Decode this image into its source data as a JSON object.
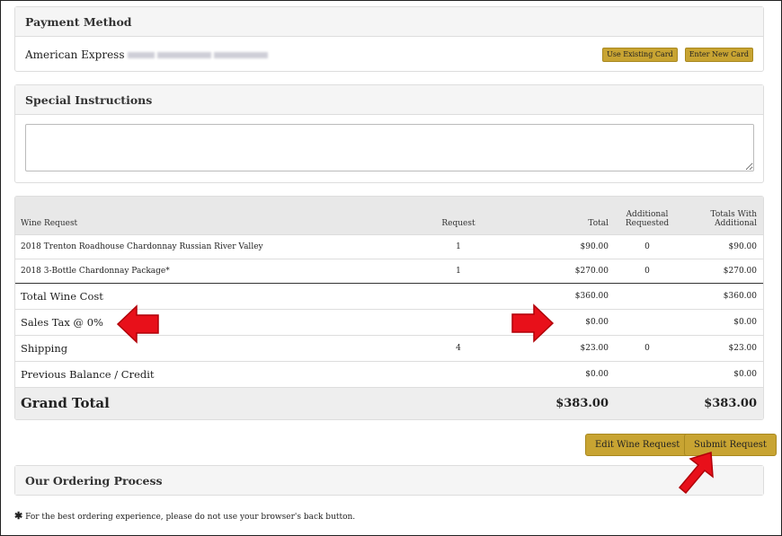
{
  "payment": {
    "title": "Payment Method",
    "card_label": "American Express",
    "use_existing_label": "Use Existing Card",
    "enter_new_label": "Enter New Card"
  },
  "instructions": {
    "title": "Special Instructions",
    "value": ""
  },
  "wine_table": {
    "headers": {
      "wine": "Wine Request",
      "request": "Request",
      "total": "Total",
      "additional1": "Additional",
      "additional2": "Requested",
      "totals_with1": "Totals With",
      "totals_with2": "Additional"
    },
    "rows": [
      {
        "wine": "2018 Trenton Roadhouse Chardonnay Russian River Valley",
        "request": "1",
        "total": "$90.00",
        "additional": "0",
        "totals_with": "$90.00"
      },
      {
        "wine": "2018 3-Bottle Chardonnay Package*",
        "request": "1",
        "total": "$270.00",
        "additional": "0",
        "totals_with": "$270.00"
      }
    ],
    "summary": [
      {
        "label": "Total Wine Cost",
        "request": "",
        "total": "$360.00",
        "additional": "",
        "totals_with": "$360.00"
      },
      {
        "label": "Sales Tax @ 0%",
        "request": "",
        "total": "$0.00",
        "additional": "",
        "totals_with": "$0.00"
      },
      {
        "label": "Shipping",
        "request": "4",
        "total": "$23.00",
        "additional": "0",
        "totals_with": "$23.00"
      },
      {
        "label": "Previous Balance / Credit",
        "request": "",
        "total": "$0.00",
        "additional": "",
        "totals_with": "$0.00"
      }
    ],
    "grand_total": {
      "label": "Grand Total",
      "total": "$383.00",
      "totals_with": "$383.00"
    }
  },
  "actions": {
    "edit_label": "Edit Wine Request",
    "submit_label": "Submit Request"
  },
  "ordering": {
    "title": "Our Ordering Process"
  },
  "footer": {
    "note": "For the best ordering experience, please do not use your browser's back button."
  },
  "colors": {
    "gold": "#c8a432",
    "arrow_red": "#e8101a"
  }
}
